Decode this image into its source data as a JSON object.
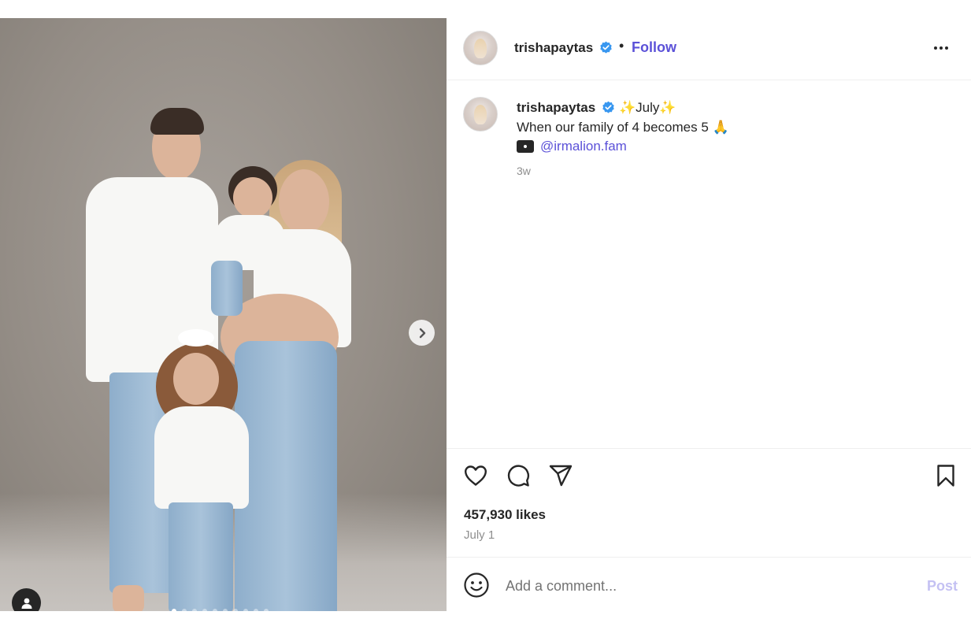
{
  "post": {
    "slide_count": 10,
    "active_slide": 1,
    "accent_color": "#5b51d8"
  },
  "header": {
    "username": "trishapaytas",
    "separator": "•",
    "follow_label": "Follow"
  },
  "caption": {
    "username": "trishapaytas",
    "title_prefix": "✨",
    "title_text": "July",
    "title_suffix": "✨",
    "line2_text": "When our family of 4 becomes 5",
    "line2_emoji": "🙏",
    "mention": "@irmalion.fam",
    "time": "3w"
  },
  "engagement": {
    "likes": "457,930 likes",
    "date": "July 1"
  },
  "comment": {
    "placeholder": "Add a comment...",
    "post_label": "Post"
  },
  "icons": {
    "like": "heart-icon",
    "comment": "comment-icon",
    "share": "paper-plane-icon",
    "save": "bookmark-icon",
    "emoji": "smiley-icon",
    "next": "chevron-right-icon",
    "tag": "user-icon",
    "more": "more-dots-icon",
    "verified": "verified-badge-icon",
    "camera": "camera-icon"
  }
}
